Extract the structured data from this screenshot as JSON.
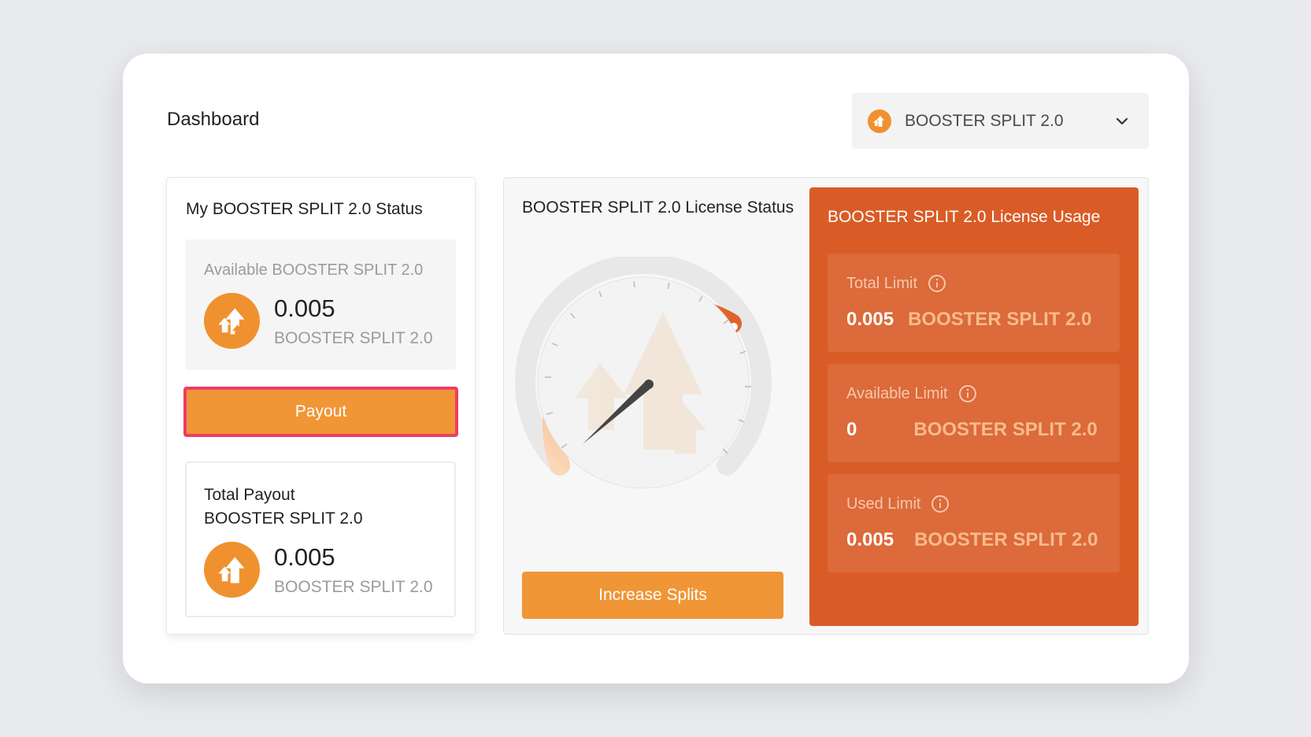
{
  "header": {
    "title": "Dashboard",
    "selector_label": "BOOSTER SPLIT 2.0"
  },
  "status": {
    "title": "My BOOSTER SPLIT 2.0 Status",
    "available_label": "Available BOOSTER SPLIT 2.0",
    "available_value": "0.005",
    "available_unit": "BOOSTER SPLIT 2.0",
    "payout_label": "Payout",
    "total_label_line1": "Total Payout",
    "total_label_line2": "BOOSTER SPLIT 2.0",
    "total_value": "0.005",
    "total_unit": "BOOSTER SPLIT 2.0"
  },
  "license": {
    "title": "BOOSTER SPLIT 2.0 License Status",
    "increase_label": "Increase Splits",
    "usage_title": "BOOSTER SPLIT 2.0 License Usage",
    "items": [
      {
        "label": "Total Limit",
        "value": "0.005",
        "unit": "BOOSTER SPLIT 2.0"
      },
      {
        "label": "Available Limit",
        "value": "0",
        "unit": "BOOSTER SPLIT 2.0"
      },
      {
        "label": "Used Limit",
        "value": "0.005",
        "unit": "BOOSTER SPLIT 2.0"
      }
    ]
  },
  "colors": {
    "accent": "#f09637",
    "usage_bg": "#d95c26",
    "payout_border": "#ef3d64"
  }
}
